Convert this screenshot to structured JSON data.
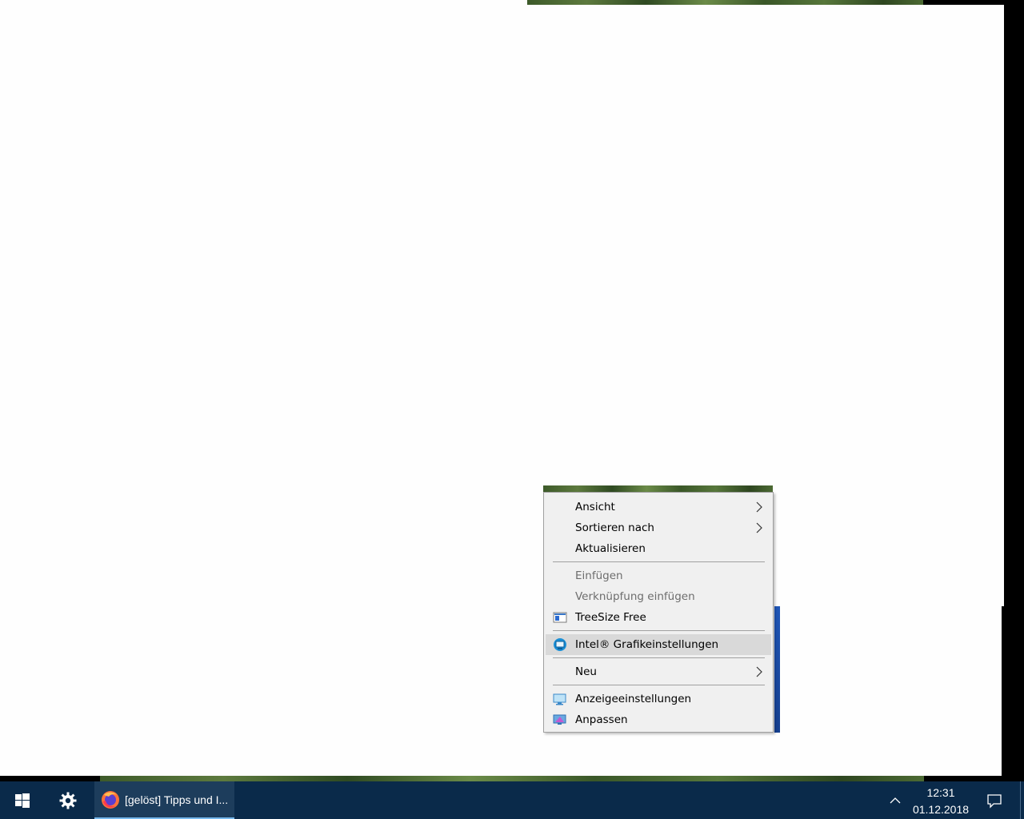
{
  "context_menu": {
    "items": [
      {
        "label": "Ansicht",
        "submenu": true,
        "enabled": true
      },
      {
        "label": "Sortieren nach",
        "submenu": true,
        "enabled": true
      },
      {
        "label": "Aktualisieren",
        "enabled": true
      },
      {
        "label": "Einfügen",
        "enabled": false
      },
      {
        "label": "Verknüpfung einfügen",
        "enabled": false
      },
      {
        "label": "TreeSize Free",
        "icon": "treesize-icon",
        "enabled": true
      },
      {
        "label": "Intel® Grafikeinstellungen",
        "icon": "intel-graphics-icon",
        "enabled": true,
        "highlighted": true
      },
      {
        "label": "Neu",
        "submenu": true,
        "enabled": true
      },
      {
        "label": "Anzeigeeinstellungen",
        "icon": "display-settings-icon",
        "enabled": true
      },
      {
        "label": "Anpassen",
        "icon": "personalize-icon",
        "enabled": true
      }
    ]
  },
  "taskbar": {
    "active_app_label": "[gelöst] Tipps und I...",
    "time": "12:31",
    "date": "01.12.2018",
    "icons": [
      "windows-start-icon",
      "settings-gear-icon",
      "firefox-icon",
      "chevron-up-icon",
      "notification-icon"
    ]
  },
  "colors": {
    "taskbar_bg": "#0a2a4a",
    "active_underline": "#76b9ed",
    "menu_bg": "#f0f0f0",
    "menu_hover": "#d9d9d9"
  }
}
